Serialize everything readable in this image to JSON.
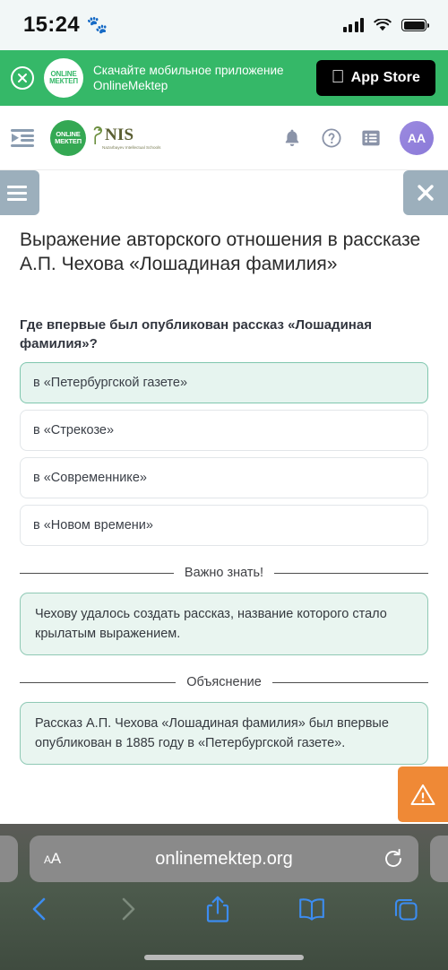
{
  "status_bar": {
    "time": "15:24",
    "paw_icon": "paw-icon",
    "signal_icon": "cellular-signal-icon",
    "wifi_icon": "wifi-icon",
    "battery_icon": "battery-full-icon"
  },
  "app_banner": {
    "close_icon": "close-circle-icon",
    "logo_line1": "ONLINE",
    "logo_line2": "МЕКТЕП",
    "message_line1": "Скачайте мобильное приложение",
    "message_line2": "OnlineMektep",
    "store_button_label": "App Store",
    "store_icon": "apple-logo-icon",
    "background_color": "#35b868"
  },
  "navbar": {
    "sidebar_toggle_icon": "sidebar-expand-icon",
    "om_logo_line1": "ONLINE",
    "om_logo_line2": "МЕКТЕП",
    "nis_logo_text": "NIS",
    "nis_logo_subtitle": "Nazarbayev Intellectual Schools",
    "icons": [
      {
        "name": "notifications-bell-icon",
        "label": "Уведомления"
      },
      {
        "name": "help-question-icon",
        "label": "Помощь"
      },
      {
        "name": "list-menu-icon",
        "label": "Список"
      }
    ],
    "avatar_initials": "AA"
  },
  "control_row": {
    "menu_button_icon": "hamburger-menu-icon",
    "close_button_icon": "close-x-icon",
    "button_color": "#9cafbc"
  },
  "lesson": {
    "title": "Выражение авторского отношения в рассказе А.П. Чехова «Лошадиная фамилия»",
    "question": "Где впервые был опубликован рассказ «Лошадиная фамилия»?",
    "options": [
      {
        "text": "в «Петербургской газете»",
        "selected": true
      },
      {
        "text": "в «Стрекозе»",
        "selected": false
      },
      {
        "text": "в «Современнике»",
        "selected": false
      },
      {
        "text": "в «Новом времени»",
        "selected": false
      }
    ],
    "important_heading": "Важно знать!",
    "important_text": "Чехову удалось создать рассказ, название которого стало крылатым выражением.",
    "explanation_heading": "Объяснение",
    "explanation_text": "Рассказ А.П. Чехова «Лошадиная фамилия» был впервые опубликован в 1885 году в «Петербургской газете».",
    "selected_color": "#e6f4ef",
    "selected_border_color": "#7fc6ae"
  },
  "warning_badge": {
    "icon": "warning-triangle-icon",
    "color": "#ef8936"
  },
  "browser": {
    "text_size_label_small": "A",
    "text_size_label_large": "A",
    "url": "onlinemektep.org",
    "reload_icon": "reload-icon",
    "back_icon": "back-chevron-icon",
    "forward_icon": "forward-chevron-icon",
    "share_icon": "share-upload-icon",
    "bookmarks_icon": "bookmarks-book-icon",
    "tabs_icon": "tabs-icon"
  }
}
